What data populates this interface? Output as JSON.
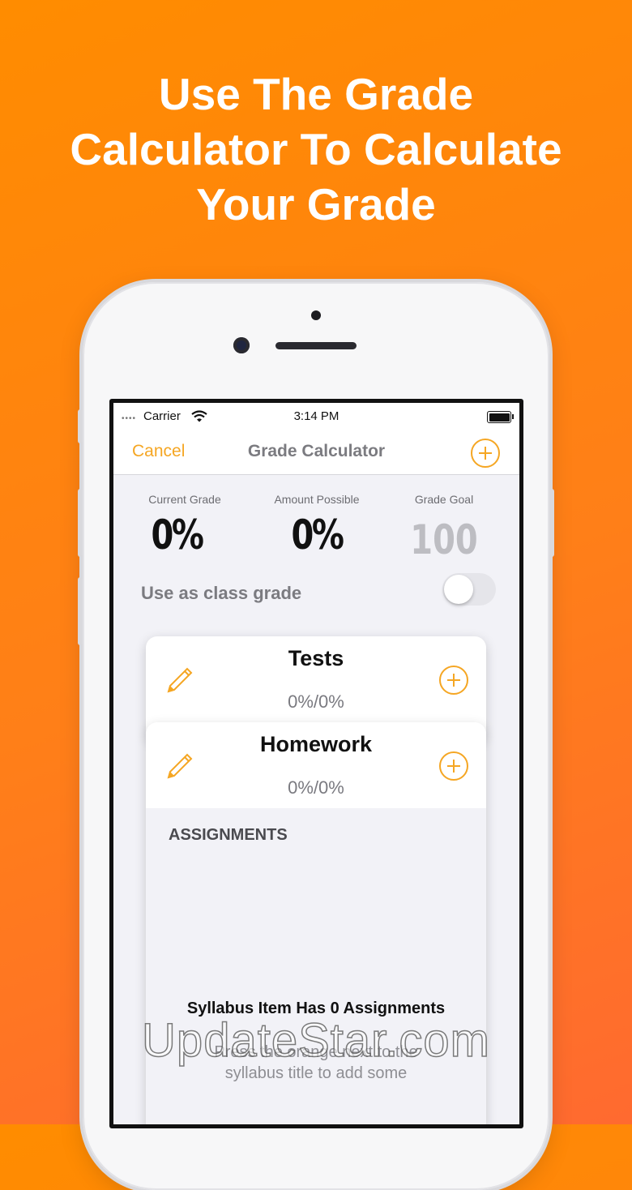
{
  "headline": [
    "Use The Grade",
    "Calculator To Calculate",
    "Your Grade"
  ],
  "status": {
    "carrier": "Carrier",
    "time": "3:14 PM"
  },
  "nav": {
    "cancel": "Cancel",
    "title": "Grade Calculator"
  },
  "stats": {
    "current_label": "Current Grade",
    "current_value": "0%",
    "possible_label": "Amount Possible",
    "possible_value": "0%",
    "goal_label": "Grade Goal",
    "goal_value": "100"
  },
  "class_grade": {
    "label": "Use as class grade",
    "enabled": false
  },
  "cards": [
    {
      "title": "Tests",
      "score": "0%/0%"
    },
    {
      "title": "Homework",
      "score": "0%/0%"
    }
  ],
  "assignments": {
    "header": "ASSIGNMENTS",
    "empty_title": "Syllabus Item Has 0 Assignments",
    "empty_hint_1": "Press the orange next to the",
    "empty_hint_2": "syllabus title to add some"
  },
  "watermark": "UpdateStar.com",
  "colors": {
    "accent": "#f5a623",
    "background": "#ff8c00"
  }
}
